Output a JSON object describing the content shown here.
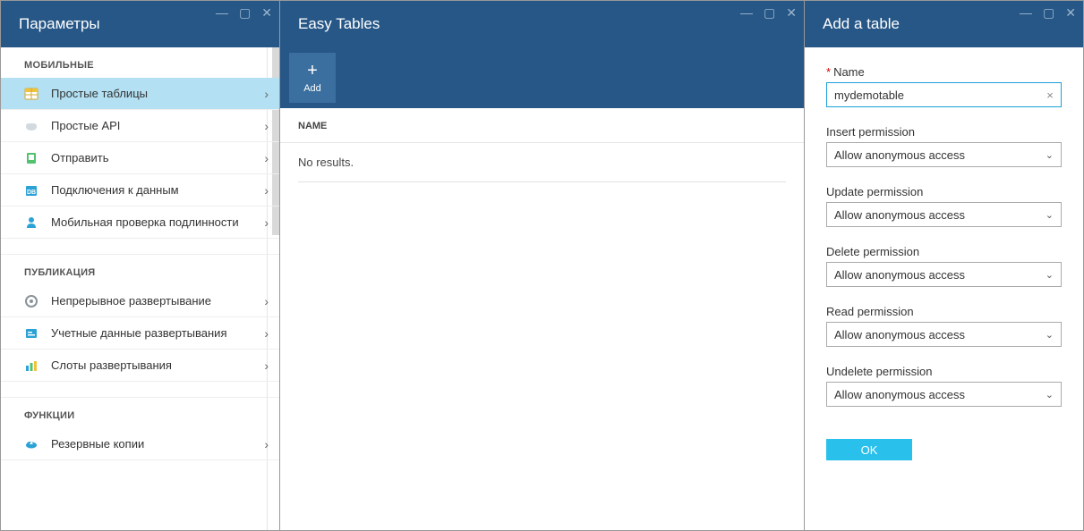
{
  "blade_params": {
    "title": "Параметры",
    "sections": [
      {
        "title": "МОБИЛЬНЫЕ",
        "items": [
          {
            "label": "Простые таблицы",
            "icon": "tables-icon",
            "iconColor1": "#f0c23e",
            "iconColor2": "#fff",
            "selected": true
          },
          {
            "label": "Простые API",
            "icon": "cloud-icon",
            "iconColor1": "#b4c2c9",
            "iconColor2": "#7b8a93"
          },
          {
            "label": "Отправить",
            "icon": "push-icon",
            "iconColor1": "#53c26f",
            "iconColor2": "#2e9e4a"
          },
          {
            "label": "Подключения к данным",
            "icon": "db-icon",
            "iconColor1": "#2aa2d6",
            "iconColor2": "#1a7bb0"
          },
          {
            "label": "Мобильная проверка подлинности",
            "icon": "user-icon",
            "iconColor1": "#2aa2d6",
            "iconColor2": "#1a7bb0"
          }
        ]
      },
      {
        "title": "ПУБЛИКАЦИЯ",
        "items": [
          {
            "label": "Непрерывное развертывание",
            "icon": "gear-icon",
            "iconColor1": "#9aa3a8",
            "iconColor2": "#6b7378"
          },
          {
            "label": "Учетные данные развертывания",
            "icon": "cred-icon",
            "iconColor1": "#2aa2d6",
            "iconColor2": "#1a7bb0"
          },
          {
            "label": "Слоты развертывания",
            "icon": "slots-icon",
            "iconColor1": "#2aa2d6",
            "iconColor2": "#f0c23e"
          }
        ]
      },
      {
        "title": "ФУНКЦИИ",
        "items": [
          {
            "label": "Резервные копии",
            "icon": "backup-icon",
            "iconColor1": "#2aa2d6",
            "iconColor2": "#1a7bb0"
          }
        ]
      }
    ]
  },
  "blade_easy": {
    "title": "Easy Tables",
    "add_label": "Add",
    "name_col": "NAME",
    "no_results": "No results."
  },
  "blade_add": {
    "title": "Add a table",
    "labels": {
      "name": "Name",
      "value": "mydemotable",
      "insert": "Insert permission",
      "update": "Update permission",
      "delete": "Delete permission",
      "read": "Read permission",
      "undelete": "Undelete permission",
      "option": "Allow anonymous access",
      "ok": "OK"
    }
  }
}
